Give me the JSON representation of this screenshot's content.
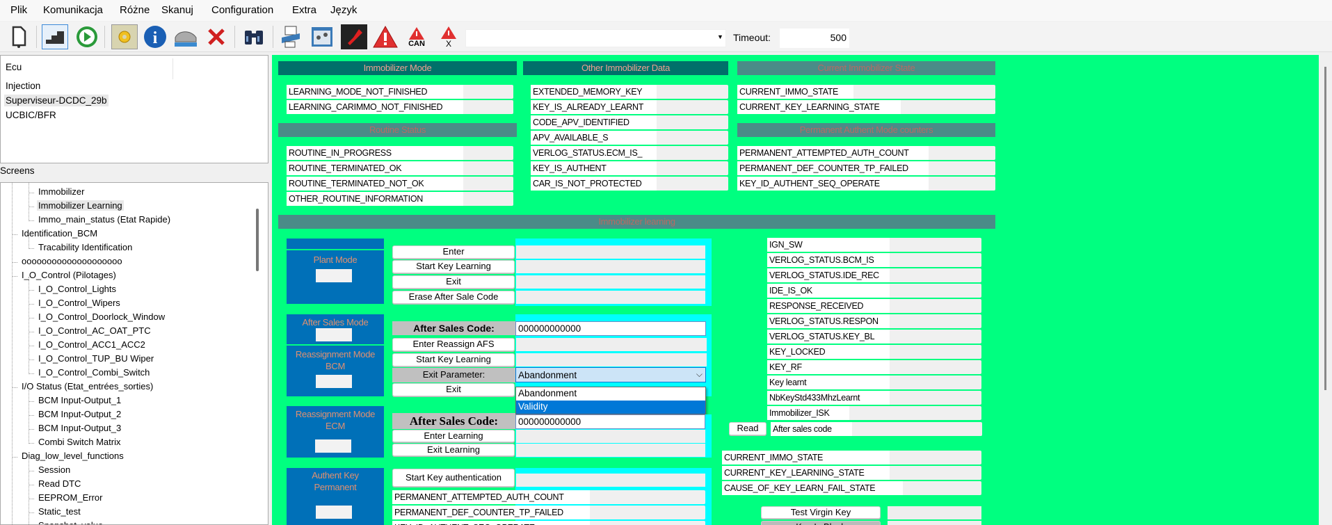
{
  "menu": [
    "Plik",
    "Komunikacja",
    "Różne",
    "Skanuj",
    "Configuration",
    "Extra",
    "Język"
  ],
  "toolbar": {
    "icons": [
      "new-file-icon",
      "stairs-icon",
      "play-icon",
      "gear-icon",
      "info-icon",
      "car-icon",
      "close-icon",
      "binoculars-icon",
      "data-shredder-icon",
      "control-panel-icon",
      "red-pin-icon",
      "warning-icon",
      "warning-can-icon",
      "warning-clear-icon"
    ],
    "can_label": "CAN",
    "x_label": "X",
    "combo_value": "",
    "timeout_label": "Timeout:",
    "timeout_value": "500"
  },
  "ecu_panel": {
    "header": "Ecu",
    "items": [
      "Injection",
      "Superviseur-DCDC_29b",
      "UCBIC/BFR"
    ],
    "selected": 1
  },
  "screens_label": "Screens",
  "tree": [
    {
      "label": "Immobilizer",
      "level": 2
    },
    {
      "label": "Immobilizer Learning",
      "level": 2,
      "selected": true
    },
    {
      "label": "Immo_main_status (Etat Rapide)",
      "level": 2
    },
    {
      "label": "Identification_BCM",
      "level": 1
    },
    {
      "label": "Tracability Identification",
      "level": 2
    },
    {
      "label": "oooooooooooooooooooo",
      "level": 1
    },
    {
      "label": "I_O_Control (Pilotages)",
      "level": 1
    },
    {
      "label": "I_O_Control_Lights",
      "level": 2
    },
    {
      "label": "I_O_Control_Wipers",
      "level": 2
    },
    {
      "label": "I_O_Control_Doorlock_Window",
      "level": 2
    },
    {
      "label": "I_O_Control_AC_OAT_PTC",
      "level": 2
    },
    {
      "label": "I_O_Control_ACC1_ACC2",
      "level": 2
    },
    {
      "label": "I_O_Control_TUP_BU Wiper",
      "level": 2
    },
    {
      "label": "I_O_Control_Combi_Switch",
      "level": 2
    },
    {
      "label": "I/O Status (Etat_entrées_sorties)",
      "level": 1
    },
    {
      "label": "BCM Input-Output_1",
      "level": 2
    },
    {
      "label": "BCM Input-Output_2",
      "level": 2
    },
    {
      "label": "BCM Input-Output_3",
      "level": 2
    },
    {
      "label": "Combi Switch Matrix",
      "level": 2
    },
    {
      "label": "Diag_low_level_functions",
      "level": 1
    },
    {
      "label": "Session",
      "level": 2
    },
    {
      "label": "Read DTC",
      "level": 2
    },
    {
      "label": "EEPROM_Error",
      "level": 2
    },
    {
      "label": "Static_test",
      "level": 2
    },
    {
      "label": "Snapshot_value",
      "level": 2
    }
  ],
  "immobilizer_mode": {
    "title": "Immobilizer Mode",
    "rows": [
      "LEARNING_MODE_NOT_FINISHED",
      "LEARNING_CARIMMO_NOT_FINISHED"
    ]
  },
  "routine_status": {
    "title": "Routine Status",
    "rows": [
      "ROUTINE_IN_PROGRESS",
      "ROUTINE_TERMINATED_OK",
      "ROUTINE_TERMINATED_NOT_OK",
      "OTHER_ROUTINE_INFORMATION"
    ]
  },
  "other_data": {
    "title": "Other Immobilizer Data",
    "rows": [
      "EXTENDED_MEMORY_KEY",
      "KEY_IS_ALREADY_LEARNT",
      "CODE_APV_IDENTIFIED",
      "APV_AVAILABLE_S",
      "VERLOG_STATUS.ECM_IS_",
      "KEY_IS_AUTHENT",
      "CAR_IS_NOT_PROTECTED"
    ]
  },
  "current_state": {
    "title": "Current Immobilizer State",
    "rows": [
      "CURRENT_IMMO_STATE",
      "CURRENT_KEY_LEARNING_STATE"
    ]
  },
  "permanent_counters": {
    "title": "Permanent Authent Mode counters",
    "rows": [
      "PERMANENT_ATTEMPTED_AUTH_COUNT",
      "PERMANENT_DEF_COUNTER_TP_FAILED",
      "KEY_ID_AUTHENT_SEQ_OPERATE"
    ]
  },
  "learning": {
    "title": "Immobilizer learning",
    "plant_mode": {
      "title": "Plant Mode",
      "buttons": [
        "Enter",
        "Start Key Learning",
        "Exit",
        "Erase After Sale Code"
      ]
    },
    "after_sales": {
      "title": "After Sales Mode",
      "code_label": "After Sales Code:",
      "code_value": "000000000000",
      "buttons": [
        "Enter Reassign AFS",
        "Start Key Learning"
      ],
      "exit_param_label": "Exit Parameter:",
      "exit_param_value": "Abandonment",
      "exit_button": "Exit",
      "options": [
        "Abandonment",
        "Validity"
      ],
      "selected_option": 1
    },
    "reassign_bcm": {
      "title1": "Reassignment Mode",
      "title2": "BCM"
    },
    "reassign_ecm": {
      "title1": "Reassignment Mode",
      "title2": "ECM",
      "code_label": "After Sales Code:",
      "code_value": "000000000000",
      "buttons": [
        "Enter Learning",
        "Exit Learning"
      ]
    },
    "authent": {
      "title1": "Authent Key",
      "title2": "Permanent",
      "button": "Start Key authentication",
      "rows": [
        "PERMANENT_ATTEMPTED_AUTH_COUNT",
        "PERMANENT_DEF_COUNTER_TP_FAILED",
        "KEY_ID_AUTHENT_SEQ_OPERATE"
      ]
    },
    "status_rows": [
      "IGN_SW",
      "VERLOG_STATUS.BCM_IS",
      "VERLOG_STATUS.IDE_REC",
      "IDE_IS_OK",
      "RESPONSE_RECEIVED",
      "VERLOG_STATUS.RESPON",
      "VERLOG_STATUS.KEY_BL",
      "KEY_LOCKED",
      "KEY_RF",
      "Key learnt",
      "NbKeyStd433MhzLearnt",
      "Immobilizer_ISK"
    ],
    "read_button": "Read",
    "after_sales_code_label": "After sales code",
    "state_rows": [
      "CURRENT_IMMO_STATE",
      "CURRENT_KEY_LEARNING_STATE",
      "CAUSE_OF_KEY_LEARN_FAIL_STATE"
    ],
    "test_virgin_button": "Test Virgin Key",
    "key_is_black_button": "Key Is Black"
  },
  "colors": {
    "background": "#00ff80",
    "header_dark": "#00706a",
    "header_light": "#4a8c88",
    "mode_block": "#0070b8",
    "value_area": "#00ffff",
    "selection": "#0078d7"
  }
}
